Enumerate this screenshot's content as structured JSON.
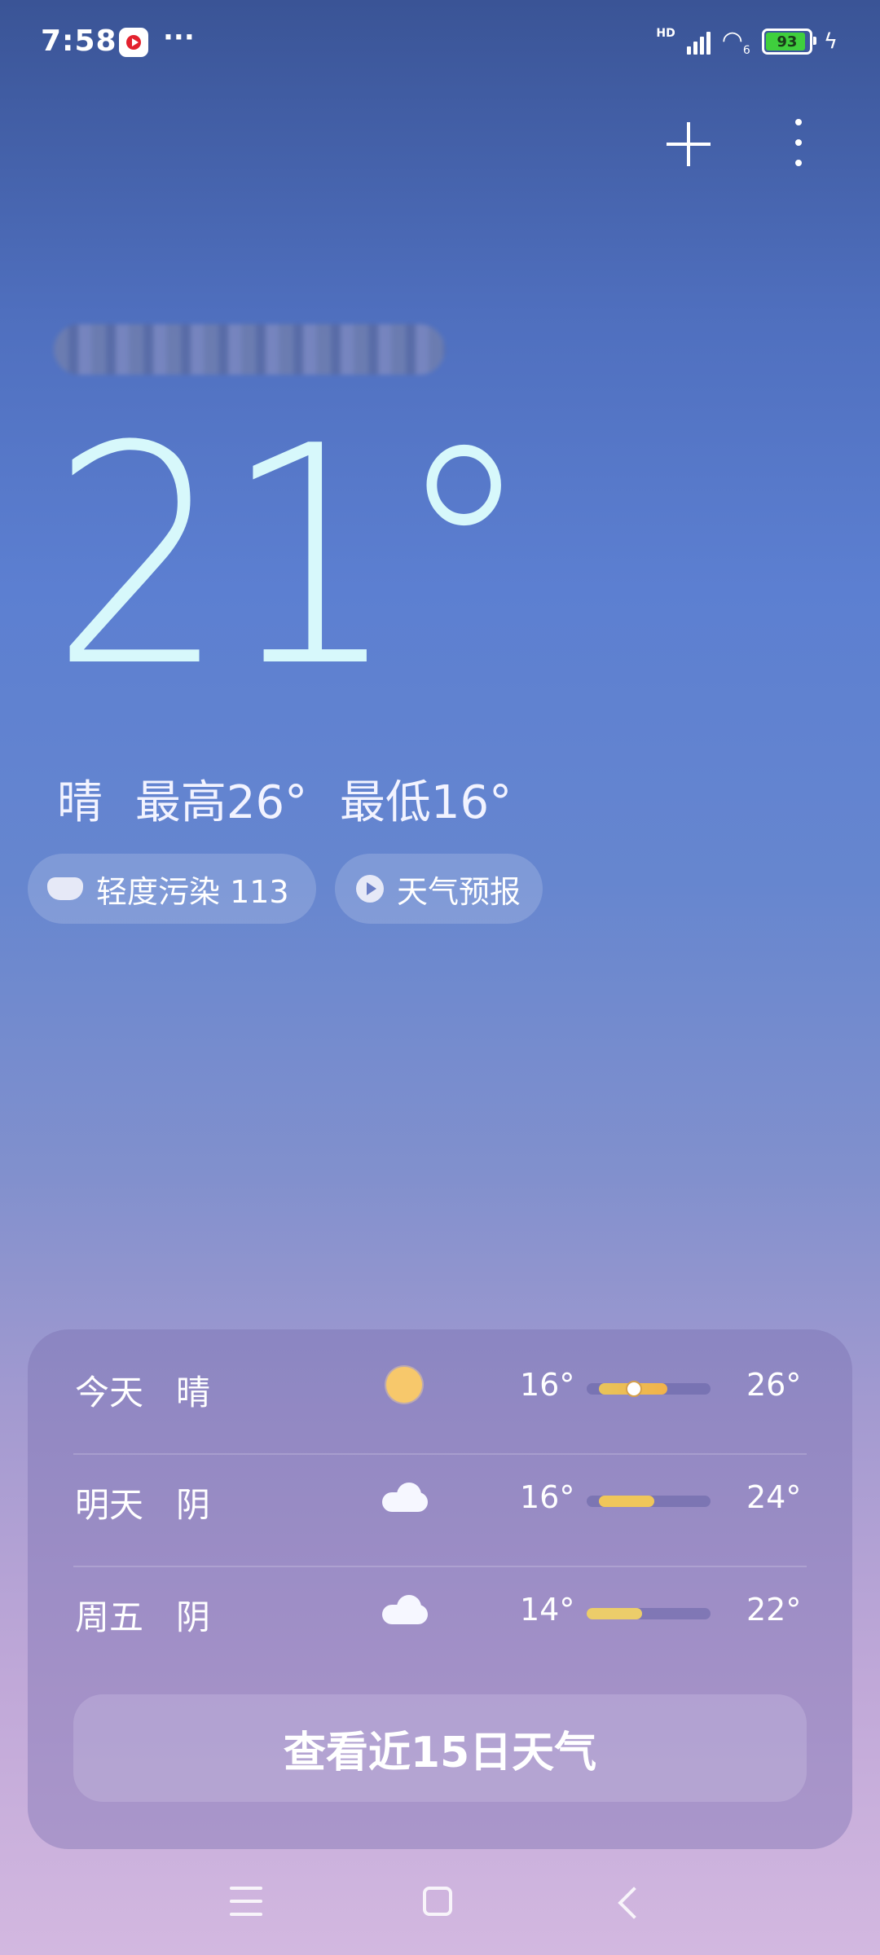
{
  "status_bar": {
    "time": "7:58",
    "overflow": "···",
    "network_label": "HD",
    "wifi_label": "6",
    "battery": "93",
    "app_icon": "video-app-icon",
    "charging_icon": "bolt-icon"
  },
  "header": {
    "add_icon": "plus-icon",
    "more_icon": "more-vertical-icon"
  },
  "current": {
    "temperature": "21°",
    "condition": "晴",
    "high": "最高26°",
    "low": "最低16°"
  },
  "chips": {
    "aqi": "轻度污染 113",
    "forecast": "天气预报"
  },
  "forecast": [
    {
      "day": "今天",
      "condition": "晴",
      "icon": "sun-icon",
      "low": "16°",
      "high": "26°",
      "bar_start": 0.1,
      "bar_end": 0.65,
      "current_marker": 0.38,
      "bar_color": "#f2c14e"
    },
    {
      "day": "明天",
      "condition": "阴",
      "icon": "cloud-icon",
      "low": "16°",
      "high": "24°",
      "bar_start": 0.1,
      "bar_end": 0.55,
      "bar_color": "#f0c65a"
    },
    {
      "day": "周五",
      "condition": "阴",
      "icon": "cloud-icon",
      "low": "14°",
      "high": "22°",
      "bar_start": 0.0,
      "bar_end": 0.45,
      "bar_color": "#eccd6a"
    }
  ],
  "fifteen_day_button": "查看近15日天气",
  "nav": {
    "menu_icon": "menu-icon",
    "home_icon": "home-icon",
    "back_icon": "back-icon"
  }
}
